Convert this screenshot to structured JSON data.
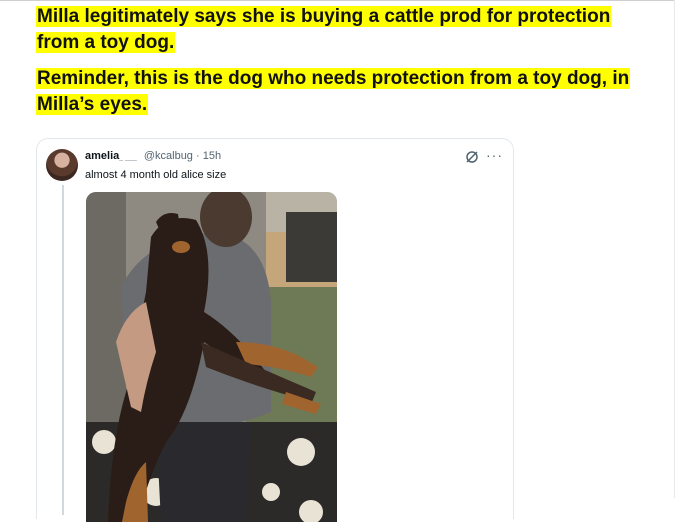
{
  "post": {
    "paragraph1": "Milla legitimately says she is buying a cattle prod for protection from a toy dog.",
    "paragraph2": "Reminder, this is the dog who needs protection from a toy dog, in Milla’s eyes."
  },
  "tweet": {
    "display_name": "amelia",
    "name_badge": "_ ___",
    "handle": "@kcalbug",
    "separator": "·",
    "time": "15h",
    "text": "almost 4 month old alice size",
    "more_label": "···",
    "icons": [
      "grok-icon",
      "more-icon"
    ]
  },
  "colors": {
    "highlight": "#ffff00",
    "body_text": "#111111",
    "muted": "#536471",
    "border": "#e3e8ec"
  }
}
